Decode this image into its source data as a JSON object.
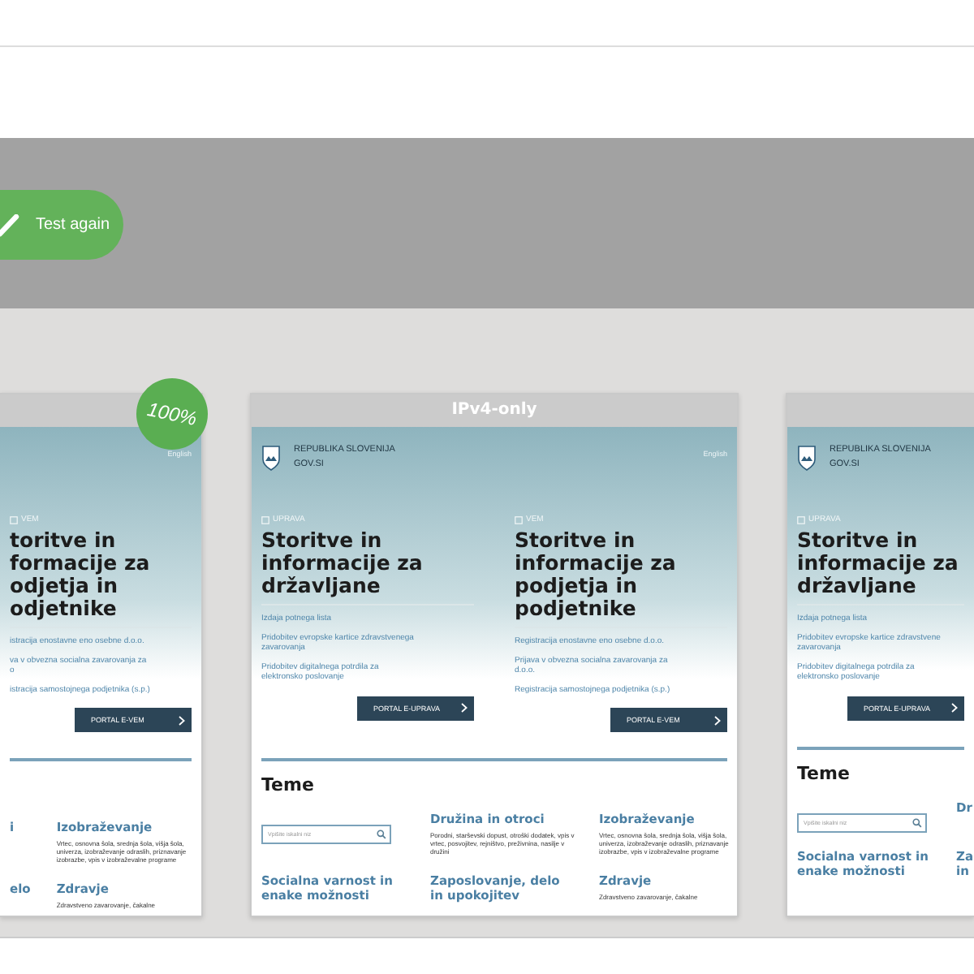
{
  "band": {
    "button": "Test again"
  },
  "cards": [
    {
      "kind": "left",
      "badge": "100%",
      "hero": {
        "language": "English",
        "columns": [
          {
            "label": "VEM",
            "heading": [
              "toritve in",
              "formacije za",
              "odjetja in",
              "odjetnike"
            ],
            "links": [
              "istracija enostavne eno osebne d.o.o.",
              "va v obvezna socialna zavarovanja za\no",
              "istracija samostojnega podjetnika (s.p.)"
            ],
            "button": "PORTAL E-VEM"
          }
        ]
      },
      "topics": [
        [
          {
            "kind": "topic",
            "title": "i"
          },
          {
            "kind": "topic",
            "title": "elo"
          }
        ],
        [
          {
            "kind": "topic",
            "title": "Izobraževanje",
            "description": "Vrtec, osnovna šola, srednja šola, višja šola, univerza, izobraževanje odraslih, priznavanje izobrazbe, vpis v izobraževalne programe"
          },
          {
            "kind": "topic",
            "title": "Zdravje",
            "description": "Zdravstveno zavarovanje, čakalne"
          }
        ]
      ]
    },
    {
      "kind": "full",
      "title": "IPv4-only",
      "hero": {
        "brand": [
          "REPUBLIKA SLOVENIJA",
          "GOV.SI"
        ],
        "language": "English",
        "columns": [
          {
            "label": "UPRAVA",
            "heading": [
              "Storitve in",
              "informacije za",
              "državljane"
            ],
            "links": [
              "Izdaja potnega lista",
              "Pridobitev evropske kartice zdravstvenega\nzavarovanja",
              "Pridobitev digitalnega potrdila za\nelektronsko poslovanje"
            ],
            "button": "PORTAL E-UPRAVA"
          },
          {
            "label": "VEM",
            "heading": [
              "Storitve in",
              "informacije za",
              "podjetja in",
              "podjetnike"
            ],
            "links": [
              "Registracija enostavne eno osebne d.o.o.",
              "Prijava v obvezna socialna zavarovanja za\nd.o.o.",
              "Registracija samostojnega podjetnika (s.p.)"
            ],
            "button": "PORTAL E-VEM"
          }
        ]
      },
      "topics_heading": "Teme",
      "topics": [
        [
          {
            "kind": "search",
            "placeholder": "Vpišite iskalni niz"
          },
          {
            "kind": "topic",
            "title": "Socialna varnost in enake možnosti"
          }
        ],
        [
          {
            "kind": "topic",
            "title": "Družina in otroci",
            "description": "Porodni, starševski dopust, otroški dodatek, vpis v vrtec, posvojitev, rejništvo, preživnina, nasilje v družini"
          },
          {
            "kind": "topic",
            "title": "Zaposlovanje, delo\nin upokojitev"
          }
        ],
        [
          {
            "kind": "topic",
            "title": "Izobraževanje",
            "description": "Vrtec, osnovna šola, srednja šola, višja šola, univerza, izobraževanje odraslih, priznavanje izobrazbe, vpis v izobraževalne programe"
          },
          {
            "kind": "topic",
            "title": "Zdravje",
            "description": "Zdravstveno zavarovanje, čakalne"
          }
        ]
      ]
    },
    {
      "kind": "right",
      "hero": {
        "brand": [
          "REPUBLIKA SLOVENIJA",
          "GOV.SI"
        ],
        "columns": [
          {
            "label": "UPRAVA",
            "heading": [
              "Storitve in",
              "informacije za",
              "državljane"
            ],
            "links": [
              "Izdaja potnega lista",
              "Pridobitev evropske kartice zdravstvene\nzavarovanja",
              "Pridobitev digitalnega potrdila za\nelektronsko poslovanje"
            ],
            "button": "PORTAL E-UPRAVA"
          }
        ]
      },
      "topics_heading": "Teme",
      "topics": [
        [
          {
            "kind": "search",
            "placeholder": "Vpišite iskalni niz"
          },
          {
            "kind": "topic",
            "title": "Socialna varnost in enake možnosti"
          }
        ],
        [
          {
            "kind": "topic",
            "title": "Dr"
          },
          {
            "kind": "topic",
            "title": "Za\nin"
          }
        ]
      ]
    }
  ]
}
